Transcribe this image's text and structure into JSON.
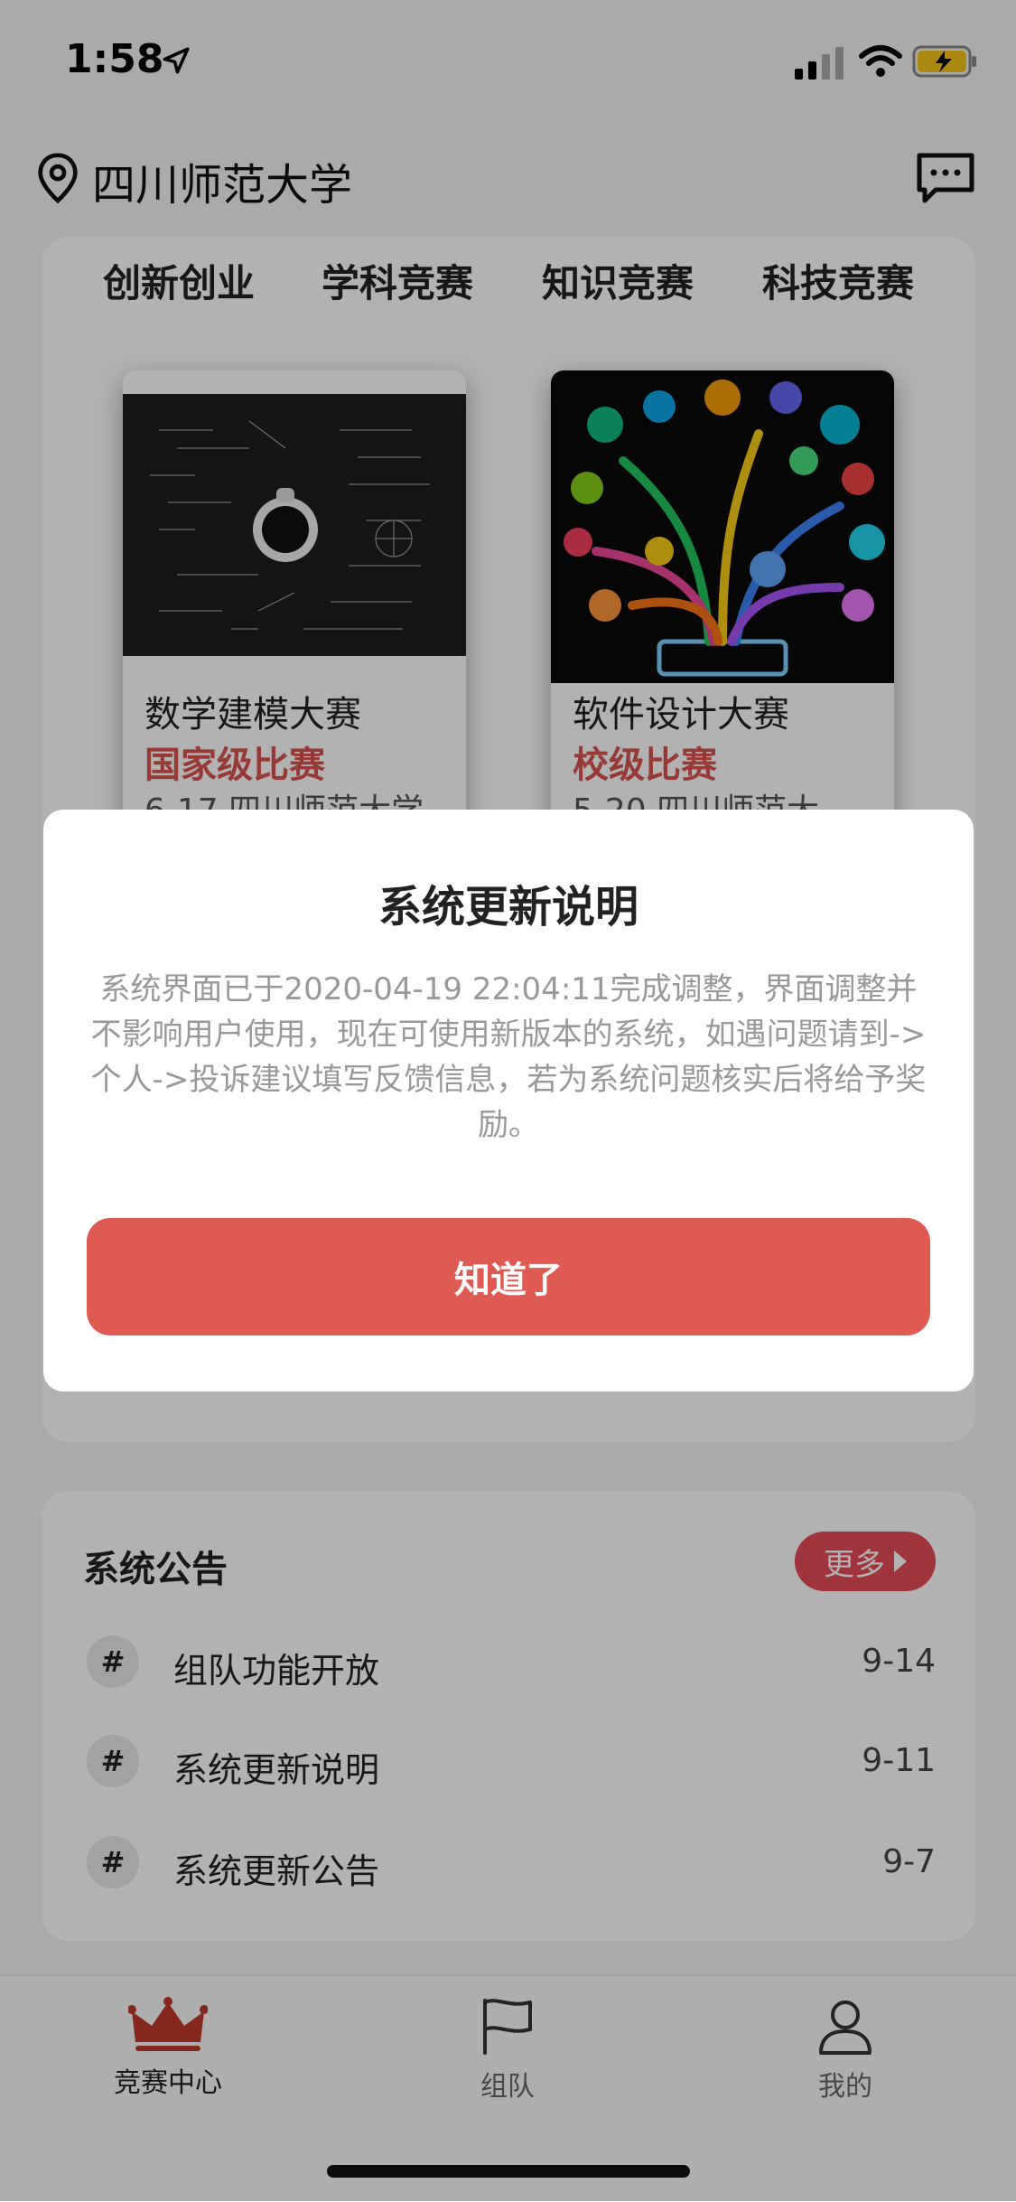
{
  "status_bar": {
    "time": "1:58"
  },
  "header": {
    "school": "四川师范大学"
  },
  "categories": [
    "创新创业",
    "学科竞赛",
    "知识竞赛",
    "科技竞赛"
  ],
  "competitions": [
    {
      "title": "数学建模大赛",
      "level": "国家级比赛",
      "meta": "6-17 四川师范大学"
    },
    {
      "title": "软件设计大赛",
      "level": "校级比赛",
      "meta": "5-20 四川师范大"
    }
  ],
  "announcements": {
    "title": "系统公告",
    "more_label": "更多",
    "items": [
      {
        "hash": "#",
        "text": "组队功能开放",
        "date": "9-14"
      },
      {
        "hash": "#",
        "text": "系统更新说明",
        "date": "9-11"
      },
      {
        "hash": "#",
        "text": "系统更新公告",
        "date": "9-7"
      }
    ]
  },
  "tabbar": [
    {
      "label": "竞赛中心",
      "icon": "crown-icon",
      "active": true
    },
    {
      "label": "组队",
      "icon": "flag-icon",
      "active": false
    },
    {
      "label": "我的",
      "icon": "user-icon",
      "active": false
    }
  ],
  "modal": {
    "title": "系统更新说明",
    "body": "系统界面已于2020-04-19 22:04:11完成调整，界面调整并不影响用户使用，现在可使用新版本的系统，如遇问题请到->个人->投诉建议填写反馈信息，若为系统问题核实后将给予奖励。",
    "button_label": "知道了"
  },
  "colors": {
    "accent": "#e05a54",
    "level": "#d9534f",
    "active_tab": "#c0392b"
  }
}
